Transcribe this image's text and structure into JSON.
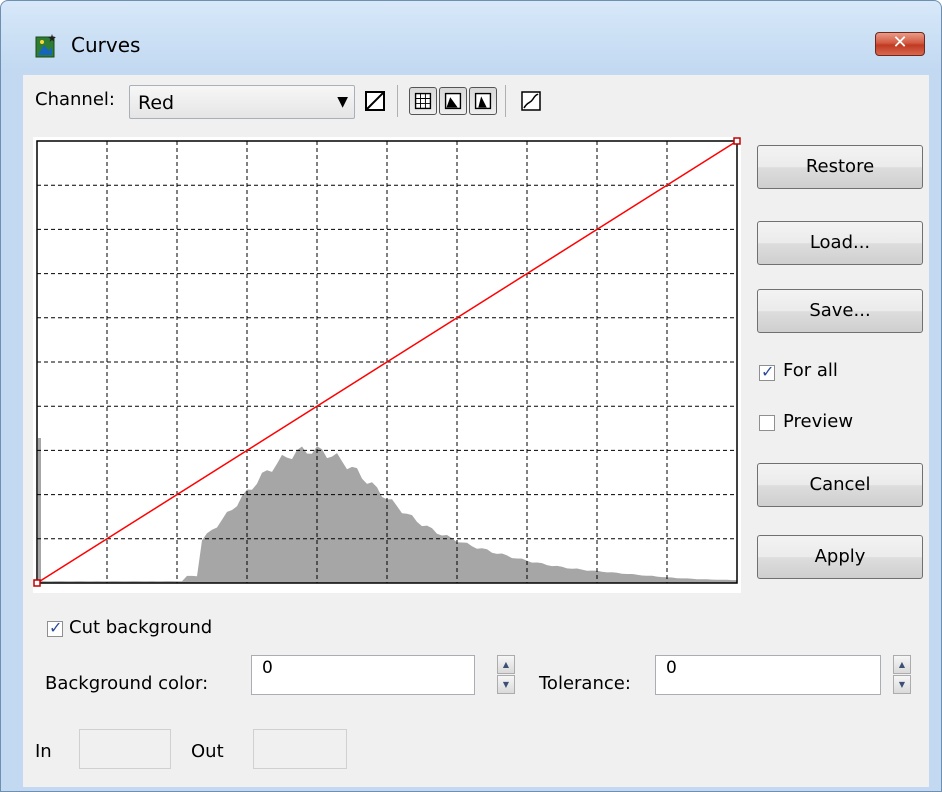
{
  "window": {
    "title": "Curves",
    "close_symbol": "✕"
  },
  "toolbar": {
    "channel_label": "Channel:",
    "channel_value": "Red",
    "icons": [
      "reset-curve-icon",
      "grid-icon",
      "histogram-icon",
      "histogram-log-icon",
      "curve-smooth-icon"
    ]
  },
  "graph": {
    "curve_color": "#ff0000",
    "histogram_color": "#a6a6a6",
    "curve_points": [
      [
        0,
        0
      ],
      [
        255,
        255
      ]
    ],
    "grid_divisions": 10
  },
  "buttons": {
    "restore": "Restore",
    "load": "Load...",
    "save": "Save...",
    "cancel": "Cancel",
    "apply": "Apply"
  },
  "options": {
    "for_all_label": "For all",
    "for_all_checked": true,
    "preview_label": "Preview",
    "preview_checked": false
  },
  "background": {
    "cut_label": "Cut background",
    "cut_checked": true,
    "color_label": "Background color:",
    "color_value": "0",
    "tolerance_label": "Tolerance:",
    "tolerance_value": "0"
  },
  "readout": {
    "in_label": "In",
    "out_label": "Out"
  }
}
